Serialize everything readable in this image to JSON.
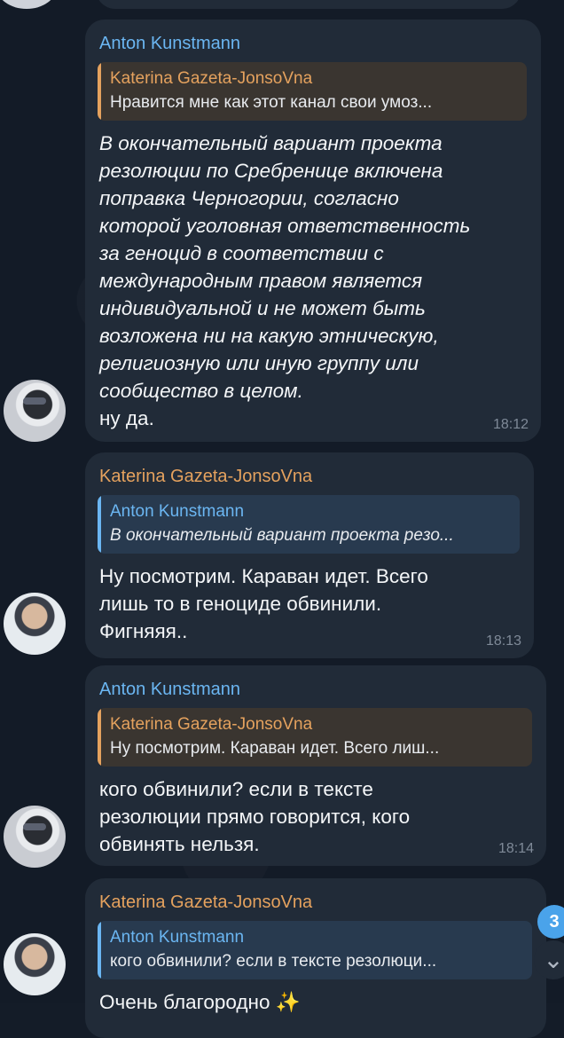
{
  "messages": [
    {
      "sender": "Anton Kunstmann",
      "reply": {
        "name": "Katerina Gazeta-JonsoVna",
        "text": "Нравится мне как этот канал свои умоз..."
      },
      "text": "В окончательный вариант проекта\nрезолюции по Сребренице включена\nпоправка Черногории, согласно\nкоторой уголовная ответственность\nза геноцид в соответствии с\nмеждународным правом является\nиндивидуальной и не может быть\nвозложена ни на какую этническую,\nрелигиозную или иную группу или\nсообщество в целом.",
      "text2": "ну да.",
      "time": "18:12"
    },
    {
      "sender": "Katerina Gazeta-JonsoVna",
      "reply": {
        "name": "Anton Kunstmann",
        "text": "В окончательный вариант проекта резо..."
      },
      "text": "Ну посмотрим. Караван идет. Всего\nлишь то в геноциде обвинили.\nФигняяя..",
      "time": "18:13"
    },
    {
      "sender": "Anton Kunstmann",
      "reply": {
        "name": "Katerina Gazeta-JonsoVna",
        "text": "Ну посмотрим. Караван идет. Всего лиш..."
      },
      "text": "кого обвинили? если в тексте\nрезолюции прямо говорится, кого\nобвинять нельзя.",
      "time": "18:14"
    },
    {
      "sender": "Katerina Gazeta-JonsoVna",
      "reply": {
        "name": "Anton Kunstmann",
        "text": "кого обвинили? если в тексте резолюци..."
      },
      "text": "Очень благородно ✨"
    }
  ],
  "unread_count": "3",
  "icons": {
    "scroll_down": "chevron-down-icon"
  },
  "colors": {
    "background": "#141c28",
    "bubble": "#212b38",
    "name_blue": "#6bb6f2",
    "name_orange": "#e5a25e",
    "badge": "#4aa3ea"
  }
}
